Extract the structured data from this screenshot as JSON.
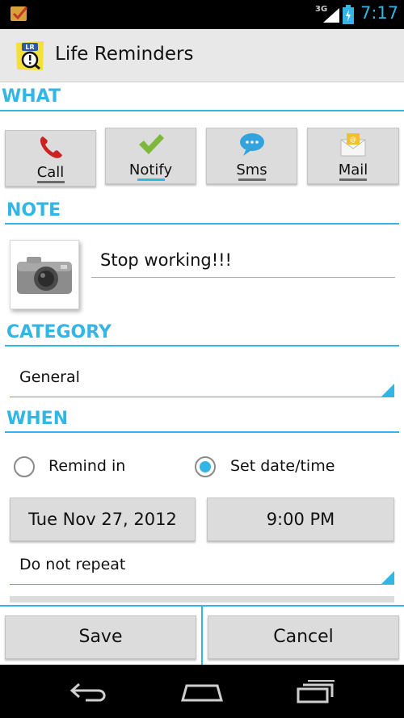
{
  "status_bar": {
    "network": "3G",
    "time": "7:17"
  },
  "action_bar": {
    "app_icon_text": "LR",
    "title": "Life Reminders"
  },
  "sections": {
    "what": "WHAT",
    "note": "NOTE",
    "category": "CATEGORY",
    "when": "WHEN"
  },
  "types": [
    {
      "label": "Call",
      "icon": "phone-icon",
      "color": "#cc2222",
      "selected": false
    },
    {
      "label": "Notify",
      "icon": "checkmark-icon",
      "color": "#7cb93a",
      "selected": true
    },
    {
      "label": "Sms",
      "icon": "chat-bubble-icon",
      "color": "#33a3dd",
      "selected": false
    },
    {
      "label": "Mail",
      "icon": "envelope-icon",
      "color": "#f0c030",
      "selected": false
    }
  ],
  "note": {
    "photo_icon": "camera-icon",
    "text": "Stop working!!!"
  },
  "category": {
    "value": "General"
  },
  "when": {
    "option_remind_in": "Remind in",
    "option_set_datetime": "Set date/time",
    "selected_option": "Set date/time",
    "date": "Tue Nov 27, 2012",
    "time": "9:00 PM",
    "repeat": "Do not repeat"
  },
  "buttons": {
    "save": "Save",
    "cancel": "Cancel"
  },
  "nav": {
    "back_icon": "back-icon",
    "home_icon": "home-icon",
    "recents_icon": "recents-icon"
  },
  "colors": {
    "accent": "#33b5e5"
  }
}
